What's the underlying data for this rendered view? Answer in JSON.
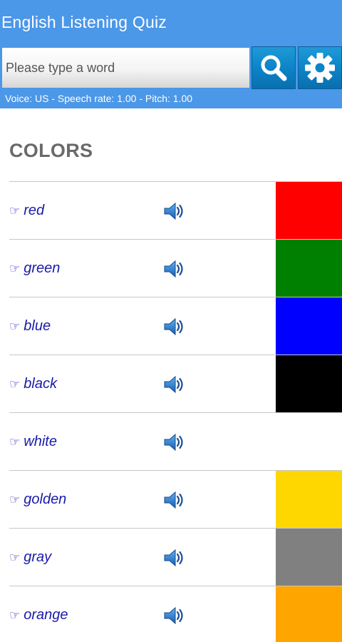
{
  "app": {
    "title": "English Listening Quiz"
  },
  "search": {
    "placeholder": "Please type a word",
    "value": "",
    "search_icon": "search-icon",
    "settings_icon": "gear-icon"
  },
  "voice_settings": "Voice: US - Speech rate: 1.00 - Pitch: 1.00",
  "section": {
    "title": "COLORS"
  },
  "words": [
    {
      "word": "red",
      "hand_icon": "pointing-hand-icon",
      "speaker_icon": "speaker-icon",
      "swatch_color": "#ff0000"
    },
    {
      "word": "green",
      "hand_icon": "pointing-hand-icon",
      "speaker_icon": "speaker-icon",
      "swatch_color": "#008000"
    },
    {
      "word": "blue",
      "hand_icon": "pointing-hand-icon",
      "speaker_icon": "speaker-icon",
      "swatch_color": "#0000ff"
    },
    {
      "word": "black",
      "hand_icon": "pointing-hand-icon",
      "speaker_icon": "speaker-icon",
      "swatch_color": "#000000"
    },
    {
      "word": "white",
      "hand_icon": "pointing-hand-icon",
      "speaker_icon": "speaker-icon",
      "swatch_color": "#ffffff"
    },
    {
      "word": "golden",
      "hand_icon": "pointing-hand-icon",
      "speaker_icon": "speaker-icon",
      "swatch_color": "#ffd700"
    },
    {
      "word": "gray",
      "hand_icon": "pointing-hand-icon",
      "speaker_icon": "speaker-icon",
      "swatch_color": "#808080"
    },
    {
      "word": "orange",
      "hand_icon": "pointing-hand-icon",
      "speaker_icon": "speaker-icon",
      "swatch_color": "#ffa500"
    }
  ],
  "colors": {
    "header_bg": "#4b97e8",
    "button_bg": "#0c84c8",
    "link_text": "#1a1aa8",
    "section_title": "#6a6a6a",
    "divider": "#c7c7c7"
  }
}
